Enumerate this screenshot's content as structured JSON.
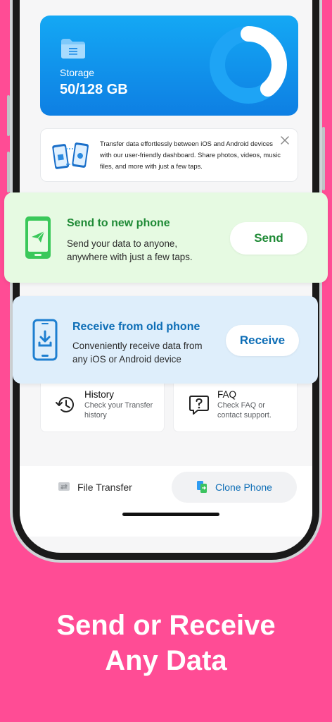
{
  "storage": {
    "label": "Storage",
    "value": "50/128 GB",
    "used_fraction": 0.39
  },
  "info_banner": {
    "text": "Transfer data effortlessly between iOS and Android devices with our user-friendly dashboard. Share photos, videos, music files, and more with just a few taps."
  },
  "send_card": {
    "title": "Send to new phone",
    "description_line1": "Send your data to anyone,",
    "description_line2": "anywhere with just a few taps.",
    "button_label": "Send",
    "accent_color": "#1F8A36",
    "icon": "phone-send-icon"
  },
  "receive_card": {
    "title": "Receive from old phone",
    "description_line1": "Conveniently receive data from",
    "description_line2": "any iOS or Android device",
    "button_label": "Receive",
    "accent_color": "#0C6DB6",
    "icon": "phone-download-icon"
  },
  "tiles": {
    "history": {
      "title": "History",
      "subtitle_line1": "Check your Transfer",
      "subtitle_line2": "history",
      "icon": "history-icon"
    },
    "faq": {
      "title": "FAQ",
      "subtitle_line1": "Check FAQ or",
      "subtitle_line2": "contact support.",
      "icon": "faq-icon"
    }
  },
  "bottom_nav": {
    "tabs": [
      {
        "label": "File Transfer",
        "icon": "file-transfer-icon",
        "active": false
      },
      {
        "label": "Clone Phone",
        "icon": "clone-phone-icon",
        "active": true
      }
    ]
  },
  "headline": {
    "line1": "Send or Receive",
    "line2": "Any Data"
  },
  "colors": {
    "background": "#FF4C95",
    "storage_card": "#0E8BE8",
    "send_card_bg": "#E6FAE2",
    "receive_card_bg": "#DEEEFB",
    "active_tab_text": "#0C6DB6"
  }
}
